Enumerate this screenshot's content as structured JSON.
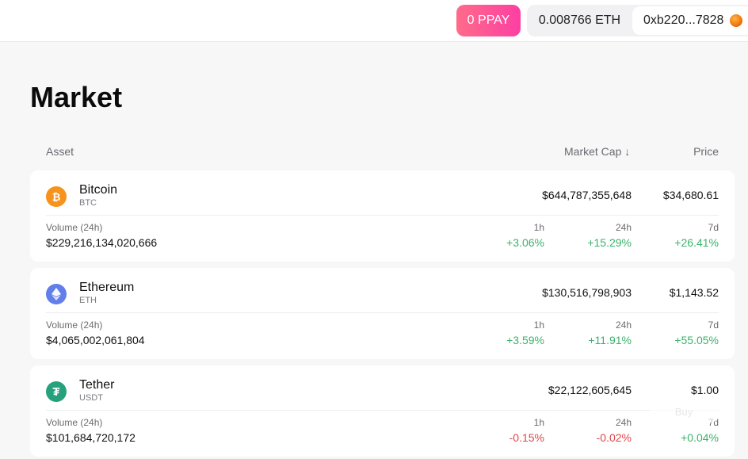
{
  "header": {
    "ppay_label": "0 PPAY",
    "eth_balance": "0.008766 ETH",
    "address": "0xb220...7828"
  },
  "page": {
    "title": "Market"
  },
  "table_head": {
    "asset": "Asset",
    "market_cap": "Market Cap ↓",
    "price": "Price"
  },
  "assets": [
    {
      "name": "Bitcoin",
      "symbol": "BTC",
      "icon": "bitcoin-icon",
      "icon_color": "#f7931a",
      "market_cap": "$644,787,355,648",
      "price": "$34,680.61",
      "volume_label": "Volume (24h)",
      "volume": "$229,216,134,020,666",
      "h1_label": "1h",
      "h1": "+3.06%",
      "h24_label": "24h",
      "h24": "+15.29%",
      "d7_label": "7d",
      "d7": "+26.41%"
    },
    {
      "name": "Ethereum",
      "symbol": "ETH",
      "icon": "ethereum-icon",
      "icon_color": "#627eea",
      "market_cap": "$130,516,798,903",
      "price": "$1,143.52",
      "volume_label": "Volume (24h)",
      "volume": "$4,065,002,061,804",
      "h1_label": "1h",
      "h1": "+3.59%",
      "h24_label": "24h",
      "h24": "+11.91%",
      "d7_label": "7d",
      "d7": "+55.05%"
    },
    {
      "name": "Tether",
      "symbol": "USDT",
      "icon": "tether-icon",
      "icon_color": "#26a17b",
      "market_cap": "$22,122,605,645",
      "price": "$1.00",
      "volume_label": "Volume (24h)",
      "volume": "$101,684,720,172",
      "h1_label": "1h",
      "h1": "-0.15%",
      "h24_label": "24h",
      "h24": "-0.02%",
      "d7_label": "7d",
      "d7": "+0.04%"
    }
  ],
  "buy_label": "Buy",
  "colors": {
    "positive": "#3bb36b",
    "negative": "#e0454a",
    "ppay_gradient_start": "#ff6b8a",
    "ppay_gradient_end": "#fd3fa3"
  }
}
